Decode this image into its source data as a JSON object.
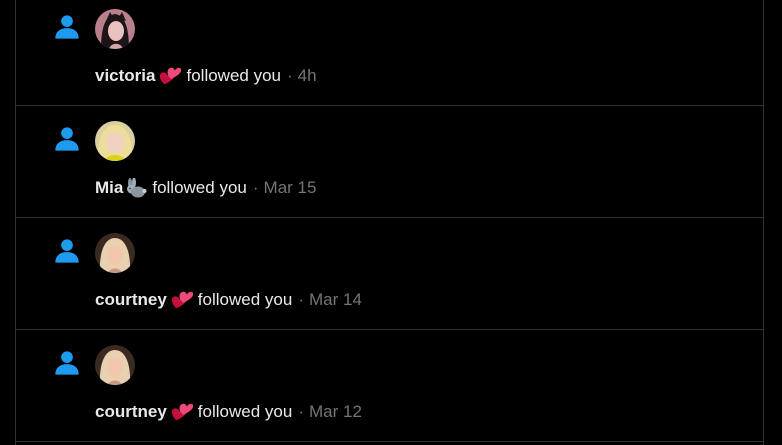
{
  "colors": {
    "accent": "#1d9bf0",
    "background": "#000000",
    "text": "#e7e9ea",
    "muted": "#71767b",
    "border": "#2f3336"
  },
  "notifications": [
    {
      "icon": "person-icon",
      "avatar": "victoria-avatar",
      "username": "victoria",
      "emoji": "hearts-emoji",
      "action": "followed you",
      "separator": "·",
      "time": "4h"
    },
    {
      "icon": "person-icon",
      "avatar": "mia-avatar",
      "username": "Mia",
      "emoji": "rabbit-emoji",
      "action": "followed you",
      "separator": "·",
      "time": "Mar 15"
    },
    {
      "icon": "person-icon",
      "avatar": "courtney-avatar",
      "username": "courtney",
      "emoji": "hearts-emoji",
      "action": "followed you",
      "separator": "·",
      "time": "Mar 14"
    },
    {
      "icon": "person-icon",
      "avatar": "courtney-avatar",
      "username": "courtney",
      "emoji": "hearts-emoji",
      "action": "followed you",
      "separator": "·",
      "time": "Mar 12"
    }
  ]
}
